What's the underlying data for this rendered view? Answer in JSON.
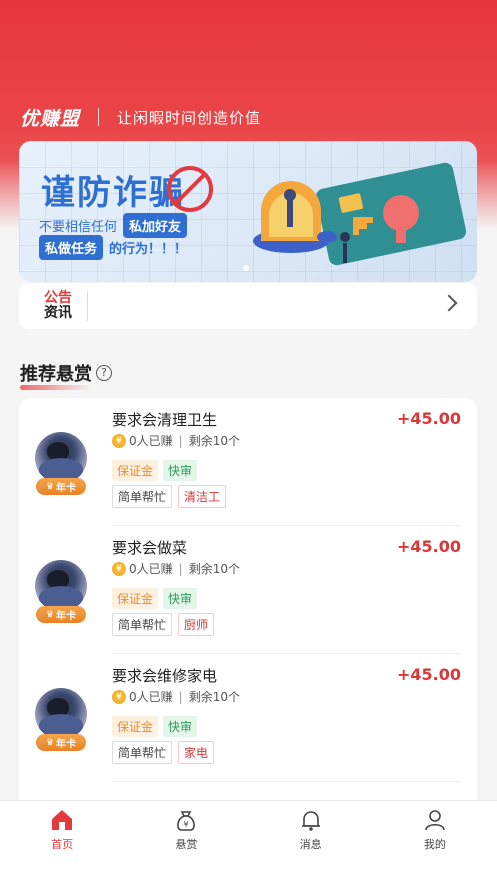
{
  "header": {
    "logo": "优赚盟",
    "slogan": "让闲暇时间创造价值"
  },
  "banner": {
    "title": "谨防诈骗",
    "line1_prefix": "不要相信任何",
    "line1_pill": "私加好友",
    "line2_pill": "私做任务",
    "line2_suffix": "的行为！！！"
  },
  "notice": {
    "logo_top": "公告",
    "logo_bottom": "资讯"
  },
  "section": {
    "title": "推荐悬赏",
    "help": "?"
  },
  "items": [
    {
      "title": "要求会清理卫生",
      "price": "+45.00",
      "earned": "0人已赚",
      "remaining": "剩余10个",
      "badge": "年卡",
      "tag_deposit": "保证金",
      "tag_fast": "快审",
      "tag_simple": "简单帮忙",
      "tag_cat": "清洁工"
    },
    {
      "title": "要求会做菜",
      "price": "+45.00",
      "earned": "0人已赚",
      "remaining": "剩余10个",
      "badge": "年卡",
      "tag_deposit": "保证金",
      "tag_fast": "快审",
      "tag_simple": "简单帮忙",
      "tag_cat": "厨师"
    },
    {
      "title": "要求会维修家电",
      "price": "+45.00",
      "earned": "0人已赚",
      "remaining": "剩余10个",
      "badge": "年卡",
      "tag_deposit": "保证金",
      "tag_fast": "快审",
      "tag_simple": "简单帮忙",
      "tag_cat": "家电"
    }
  ],
  "tabbar": {
    "home": "首页",
    "reward": "悬赏",
    "message": "消息",
    "mine": "我的"
  },
  "colors": {
    "brand_red": "#e33a3d",
    "price_red": "#d9383a",
    "banner_blue": "#2f6fd1"
  }
}
